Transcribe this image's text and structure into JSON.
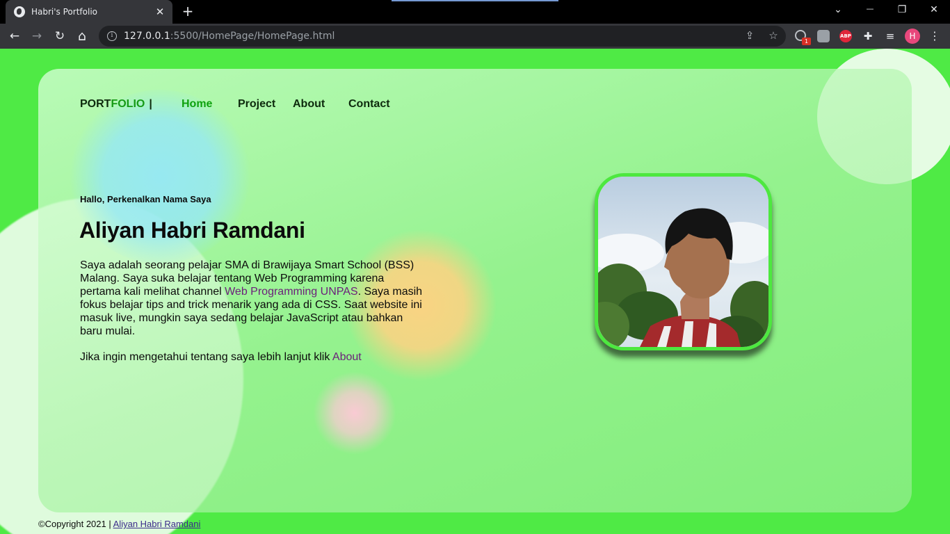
{
  "browser": {
    "tab_title": "Habri's Portfolio",
    "tab_close": "✕",
    "new_tab": "+",
    "url_host": "127.0.0.1",
    "url_rest": ":5500/HomePage/HomePage.html",
    "extension_badge": "1",
    "abp_label": "ABP",
    "profile_initial": "H",
    "window_controls": {
      "dropdown": "⌄",
      "minimize": "—",
      "restore": "❐",
      "close": "✕"
    },
    "nav_buttons": {
      "back": "←",
      "forward": "→",
      "reload": "↻",
      "home": "⌂"
    }
  },
  "nav": {
    "logo_port": "PORT",
    "logo_folio": "FOLIO",
    "logo_bar": "|",
    "links": [
      "Home",
      "Project",
      "About",
      "Contact"
    ],
    "active": "Home"
  },
  "hero": {
    "greeting": "Hallo, Perkenalkan Nama Saya",
    "name": "Aliyan Habri Ramdani",
    "bio_before": "Saya adalah seorang pelajar SMA di Brawijaya Smart School (BSS) Malang. Saya suka belajar tentang Web Programming karena pertama kali melihat channel ",
    "bio_link": "Web Programming UNPAS",
    "bio_after": ". Saya masih fokus belajar tips and trick menarik yang ada di CSS. Saat website ini masuk live, mungkin saya sedang belajar JavaScript atau bahkan baru mulai.",
    "more_text": "Jika ingin mengetahui tentang saya lebih lanjut klik ",
    "more_link": "About"
  },
  "footer": {
    "copyright": "©Copyright 2021 | ",
    "author_link": "Aliyan Habri Ramdani"
  },
  "colors": {
    "page_bg": "#4fea45",
    "accent_green": "#169a16",
    "link_purple": "#6b1f7a",
    "photo_border": "#4de83f"
  }
}
